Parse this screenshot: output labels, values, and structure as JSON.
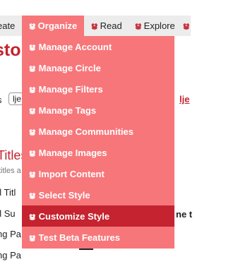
{
  "nav": {
    "create": "eate",
    "organize": "Organize",
    "read": "Read",
    "explore": "Explore"
  },
  "menu": {
    "items": [
      {
        "label": "Manage Account"
      },
      {
        "label": "Manage Circle"
      },
      {
        "label": "Manage Filters"
      },
      {
        "label": "Manage Tags"
      },
      {
        "label": "Manage Communities"
      },
      {
        "label": "Manage Images"
      },
      {
        "label": "Import Content"
      },
      {
        "label": "Select Style"
      },
      {
        "label": "Customize Style",
        "active": true
      },
      {
        "label": "Test Beta Features"
      }
    ]
  },
  "background": {
    "heading": "stor",
    "row_label": "s",
    "input_value": "lje",
    "link_right": "lje",
    "titles_heading": "Titles",
    "titles_sub": "titles a",
    "field1": "al Titl",
    "field2": "al Su",
    "bold_right": "ne t",
    "field3": "ng Pa",
    "field4": "ng Pa"
  },
  "colors": {
    "menu_bg": "#f7767a",
    "menu_active_bg": "#c4232f",
    "brand_red": "#c4232f",
    "navbar_bg": "#ececec"
  },
  "icons": {
    "menu_item_icon": "swirl-logo-icon"
  }
}
